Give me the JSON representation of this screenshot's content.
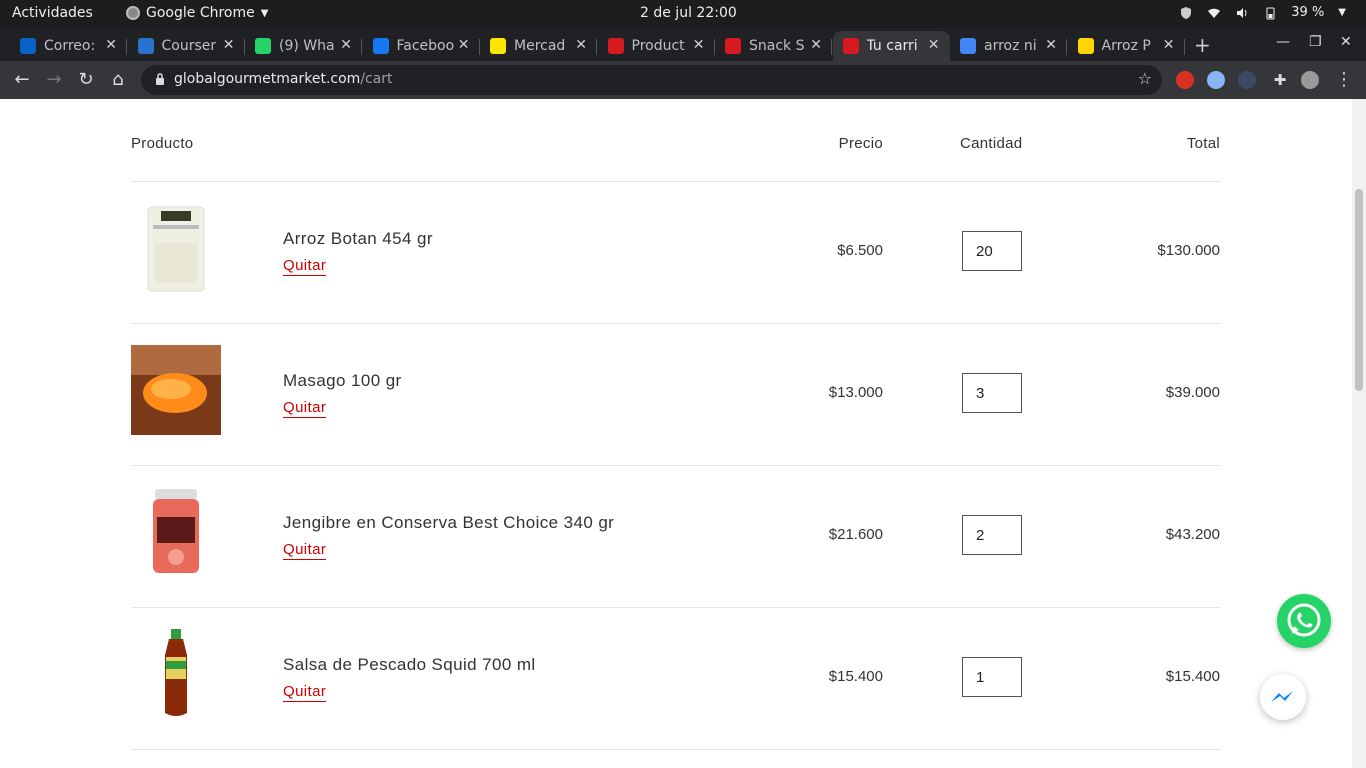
{
  "system": {
    "activities": "Actividades",
    "app_name": "Google Chrome",
    "clock": "2 de jul  22:00",
    "battery": "39 %"
  },
  "tabs": [
    {
      "title": "Correo:",
      "favicon_color": "#0a64c8"
    },
    {
      "title": "Courser",
      "favicon_color": "#2a73cc"
    },
    {
      "title": "(9) Wha",
      "favicon_color": "#25d366"
    },
    {
      "title": "Faceboo",
      "favicon_color": "#1877f2"
    },
    {
      "title": "Mercad",
      "favicon_color": "#ffe600"
    },
    {
      "title": "Product",
      "favicon_color": "#d71920"
    },
    {
      "title": "Snack S",
      "favicon_color": "#d71920"
    },
    {
      "title": "Tu carri",
      "favicon_color": "#d71920",
      "active": true
    },
    {
      "title": "arroz ni",
      "favicon_color": "#4285f4"
    },
    {
      "title": "Arroz P",
      "favicon_color": "#ffd400"
    }
  ],
  "address": {
    "domain": "globalgourmetmarket.com",
    "path": "/cart"
  },
  "cart": {
    "headers": {
      "product": "Producto",
      "price": "Precio",
      "quantity": "Cantidad",
      "total": "Total"
    },
    "remove_label": "Quitar",
    "items": [
      {
        "name": "Arroz Botan 454 gr",
        "price": "$6.500",
        "qty": "20",
        "total": "$130.000"
      },
      {
        "name": "Masago 100 gr",
        "price": "$13.000",
        "qty": "3",
        "total": "$39.000"
      },
      {
        "name": "Jengibre en Conserva Best Choice 340 gr",
        "price": "$21.600",
        "qty": "2",
        "total": "$43.200"
      },
      {
        "name": "Salsa de Pescado Squid 700 ml",
        "price": "$15.400",
        "qty": "1",
        "total": "$15.400"
      }
    ]
  },
  "colors": {
    "remove_link": "#d10000",
    "whatsapp": "#25d366",
    "messenger": "#0084ff"
  }
}
